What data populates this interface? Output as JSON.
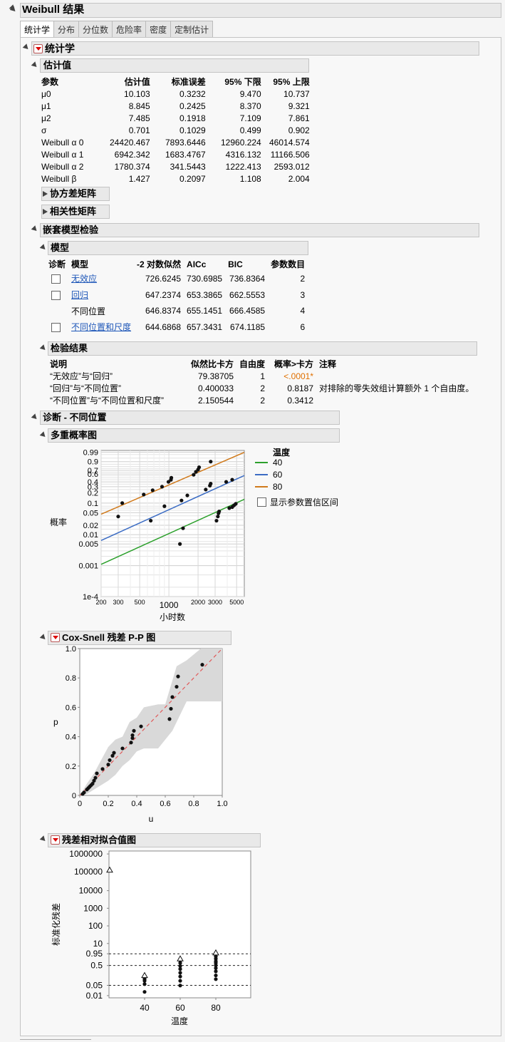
{
  "title": "Weibull 结果",
  "tabs": [
    "统计学",
    "分布",
    "分位数",
    "危险率",
    "密度",
    "定制估计"
  ],
  "stats": {
    "title": "统计学"
  },
  "estimates": {
    "title": "估计值",
    "headers": [
      "参数",
      "估计值",
      "标准误差",
      "95% 下限",
      "95% 上限"
    ],
    "rows": [
      [
        "μ0",
        "10.103",
        "0.3232",
        "9.470",
        "10.737"
      ],
      [
        "μ1",
        "8.845",
        "0.2425",
        "8.370",
        "9.321"
      ],
      [
        "μ2",
        "7.485",
        "0.1918",
        "7.109",
        "7.861"
      ],
      [
        "σ",
        "0.701",
        "0.1029",
        "0.499",
        "0.902"
      ],
      [
        "Weibull α 0",
        "24420.467",
        "7893.6446",
        "12960.224",
        "46014.574"
      ],
      [
        "Weibull α 1",
        "6942.342",
        "1683.4767",
        "4316.132",
        "11166.506"
      ],
      [
        "Weibull α 2",
        "1780.374",
        "341.5443",
        "1222.413",
        "2593.012"
      ],
      [
        "Weibull β",
        "1.427",
        "0.2097",
        "1.108",
        "2.004"
      ]
    ]
  },
  "cov_title": "协方差矩阵",
  "corr_title": "相关性矩阵",
  "nested": {
    "title": "嵌套模型检验"
  },
  "models": {
    "title": "模型",
    "headers": [
      "诊断",
      "模型",
      "-2 对数似然",
      "AICc",
      "BIC",
      "参数数目"
    ],
    "rows": [
      {
        "name": "无效应",
        "link": true,
        "checkbox": true,
        "ll": "726.6245",
        "aicc": "730.6985",
        "bic": "736.8364",
        "n": "2"
      },
      {
        "name": "回归",
        "link": true,
        "checkbox": true,
        "ll": "647.2374",
        "aicc": "653.3865",
        "bic": "662.5553",
        "n": "3"
      },
      {
        "name": "不同位置",
        "link": false,
        "checkbox": false,
        "ll": "646.8374",
        "aicc": "655.1451",
        "bic": "666.4585",
        "n": "4"
      },
      {
        "name": "不同位置和尺度",
        "link": true,
        "checkbox": true,
        "ll": "644.6868",
        "aicc": "657.3431",
        "bic": "674.1185",
        "n": "6"
      }
    ]
  },
  "tests": {
    "title": "检验结果",
    "headers": [
      "说明",
      "似然比卡方",
      "自由度",
      "概率>卡方",
      "注释"
    ],
    "rows": [
      [
        "“无效应”与“回归”",
        "79.38705",
        "1",
        "<.0001*",
        ""
      ],
      [
        "“回归”与“不同位置”",
        "0.400033",
        "2",
        "0.8187",
        "对排除的零失效组计算额外 1 个自由度。"
      ],
      [
        "“不同位置”与“不同位置和尺度”",
        "2.150544",
        "2",
        "0.3412",
        ""
      ]
    ]
  },
  "diag": {
    "title": "诊断 - 不同位置"
  },
  "multi": {
    "title": "多重概率图",
    "ylabel": "概率",
    "xlabel": "小时数",
    "yticks": [
      "0.99",
      "0.9",
      "0.7",
      "0.6",
      "0.4",
      "0.3",
      "0.2",
      "0.1",
      "0.05",
      "0.02",
      "0.01",
      "0.005",
      "0.001",
      "1e-4"
    ],
    "xticks": [
      "200",
      "300",
      "500",
      "1000",
      "2000",
      "3000",
      "5000"
    ],
    "xticks_big": [
      "1000"
    ],
    "legend_title": "温度",
    "legend": [
      {
        "name": "40",
        "color": "#2ca02c"
      },
      {
        "name": "60",
        "color": "#3b6cc4"
      },
      {
        "name": "80",
        "color": "#d07a1c"
      }
    ],
    "show_ci": "显示参数置信区间"
  },
  "coxsnell": {
    "title": "Cox-Snell 残差 P-P 图",
    "ylabel": "p",
    "xlabel": "u",
    "ticks": [
      "0",
      "0.2",
      "0.4",
      "0.6",
      "0.8",
      "1.0"
    ]
  },
  "resid": {
    "title": "残差相对拟合值图",
    "ylabel": "标准化残差",
    "xlabel": "温度",
    "yticks": [
      "1000000",
      "100000",
      "10000",
      "1000",
      "100",
      "10",
      "0.95",
      "0.5",
      "0.05",
      "0.01"
    ],
    "xticks": [
      "40",
      "60",
      "80"
    ]
  },
  "chart_data": [
    {
      "type": "scatter",
      "title": "多重概率图",
      "xlabel": "小时数",
      "ylabel": "概率",
      "x_scale": "log",
      "y_scale": "weibull-probability",
      "series": [
        {
          "name": "40",
          "points": [
            [
              1300,
              0.005
            ],
            [
              1400,
              0.016
            ],
            [
              3100,
              0.028
            ],
            [
              3200,
              0.038
            ],
            [
              3250,
              0.048
            ],
            [
              3300,
              0.055
            ],
            [
              4200,
              0.07
            ],
            [
              4500,
              0.075
            ],
            [
              4700,
              0.085
            ],
            [
              4900,
              0.095
            ]
          ]
        },
        {
          "name": "60",
          "points": [
            [
              300,
              0.038
            ],
            [
              650,
              0.028
            ],
            [
              900,
              0.08
            ],
            [
              1350,
              0.12
            ],
            [
              1550,
              0.17
            ],
            [
              2400,
              0.25
            ],
            [
              2650,
              0.32
            ],
            [
              2700,
              0.36
            ],
            [
              3900,
              0.4
            ],
            [
              4500,
              0.45
            ]
          ]
        },
        {
          "name": "80",
          "points": [
            [
              330,
              0.1
            ],
            [
              550,
              0.18
            ],
            [
              680,
              0.24
            ],
            [
              850,
              0.3
            ],
            [
              990,
              0.4
            ],
            [
              1050,
              0.45
            ],
            [
              1060,
              0.5
            ],
            [
              1800,
              0.58
            ],
            [
              1900,
              0.66
            ],
            [
              2000,
              0.72
            ],
            [
              2050,
              0.78
            ],
            [
              2700,
              0.9
            ]
          ]
        }
      ]
    },
    {
      "type": "scatter",
      "title": "Cox-Snell 残差 P-P 图",
      "xlabel": "u",
      "ylabel": "p",
      "xlim": [
        0,
        1
      ],
      "ylim": [
        0,
        1
      ],
      "points": [
        [
          0.02,
          0.01
        ],
        [
          0.03,
          0.02
        ],
        [
          0.05,
          0.04
        ],
        [
          0.06,
          0.05
        ],
        [
          0.07,
          0.06
        ],
        [
          0.08,
          0.07
        ],
        [
          0.09,
          0.08
        ],
        [
          0.1,
          0.1
        ],
        [
          0.11,
          0.12
        ],
        [
          0.12,
          0.15
        ],
        [
          0.16,
          0.18
        ],
        [
          0.2,
          0.21
        ],
        [
          0.21,
          0.24
        ],
        [
          0.23,
          0.27
        ],
        [
          0.24,
          0.29
        ],
        [
          0.3,
          0.32
        ],
        [
          0.36,
          0.36
        ],
        [
          0.37,
          0.39
        ],
        [
          0.37,
          0.41
        ],
        [
          0.38,
          0.44
        ],
        [
          0.43,
          0.47
        ],
        [
          0.63,
          0.52
        ],
        [
          0.64,
          0.59
        ],
        [
          0.65,
          0.67
        ],
        [
          0.68,
          0.74
        ],
        [
          0.69,
          0.81
        ],
        [
          0.86,
          0.89
        ]
      ]
    },
    {
      "type": "scatter",
      "title": "残差相对拟合值图",
      "xlabel": "温度",
      "ylabel": "标准化残差",
      "series": [
        {
          "name": "40",
          "values": [
            0.015,
            0.035,
            0.05,
            0.06,
            0.07
          ]
        },
        {
          "name": "60",
          "values": [
            0.03,
            0.05,
            0.08,
            0.12,
            0.18,
            0.25,
            0.35,
            0.45
          ]
        },
        {
          "name": "80",
          "values": [
            0.06,
            0.09,
            0.14,
            0.2,
            0.27,
            0.35,
            0.42,
            0.55,
            0.7,
            0.85
          ]
        }
      ]
    }
  ]
}
